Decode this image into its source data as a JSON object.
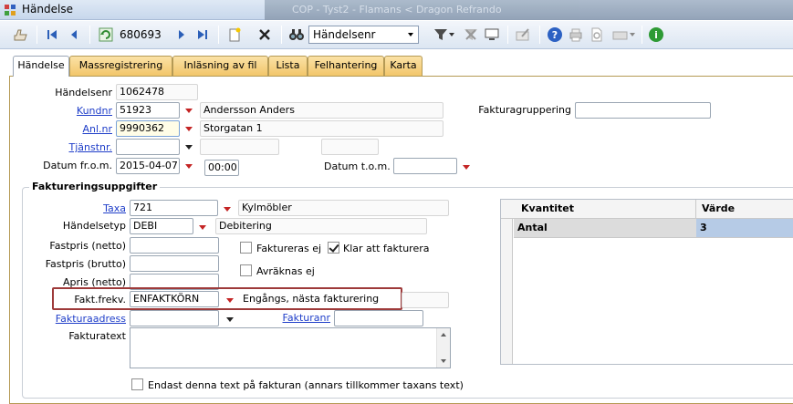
{
  "window": {
    "title": "Händelse",
    "ghost_title": "COP - Tyst2 - Flamans < Dragon Refrando"
  },
  "toolbar": {
    "record_number": "680693",
    "search_field": "Händelsenr"
  },
  "tabs": [
    "Händelse",
    "Massregistrering",
    "Inläsning av fil",
    "Lista",
    "Felhantering",
    "Karta"
  ],
  "header": {
    "handelsenr_label": "Händelsenr",
    "handelsenr_value": "1062478",
    "kundnr_label": "Kundnr",
    "kundnr_value": "51923",
    "kundnamn": "Andersson Anders",
    "anlnr_label": "Anl.nr",
    "anlnr_value": "9990362",
    "adress": "Storgatan 1",
    "tjanstnr_label": "Tjänstnr.",
    "tjanstnr_value": "",
    "datum_from_label": "Datum fr.o.m.",
    "datum_from_value": "2015-04-07",
    "tid_value": "00:00",
    "datum_tom_label": "Datum t.o.m.",
    "datum_tom_value": "",
    "fakturagruppering_label": "Fakturagruppering",
    "fakturagruppering_value": ""
  },
  "faktura": {
    "group_title": "Faktureringsuppgifter",
    "taxa_label": "Taxa",
    "taxa_value": "721",
    "taxa_text": "Kylmöbler",
    "handelsetyp_label": "Händelsetyp",
    "handelsetyp_value": "DEBI",
    "handelsetyp_text": "Debitering",
    "fastpris_netto_label": "Fastpris (netto)",
    "fastpris_brutto_label": "Fastpris (brutto)",
    "apris_netto_label": "Apris (netto)",
    "faktureras_ej_label": "Faktureras ej",
    "faktureras_ej": false,
    "klar_label": "Klar att fakturera",
    "klar": true,
    "avraknas_ej_label": "Avräknas ej",
    "avraknas_ej": false,
    "fakt_frekv_label": "Fakt.frekv.",
    "fakt_frekv_value": "ENFAKTKÖRN",
    "fakt_frekv_text": "Engångs, nästa fakturering",
    "fakturaadress_label": "Fakturaadress",
    "fakturaadress_value": "",
    "fakturanr_label": "Fakturanr",
    "fakturanr_value": "",
    "fakturatext_label": "Fakturatext",
    "fakturatext_value": "",
    "endast_label": "Endast denna text på fakturan (annars tillkommer taxans text)",
    "endast": false
  },
  "grid": {
    "columns": [
      "Kvantitet",
      "Värde"
    ],
    "rows": [
      {
        "kvantitet": "Antal",
        "varde": "3"
      }
    ]
  }
}
